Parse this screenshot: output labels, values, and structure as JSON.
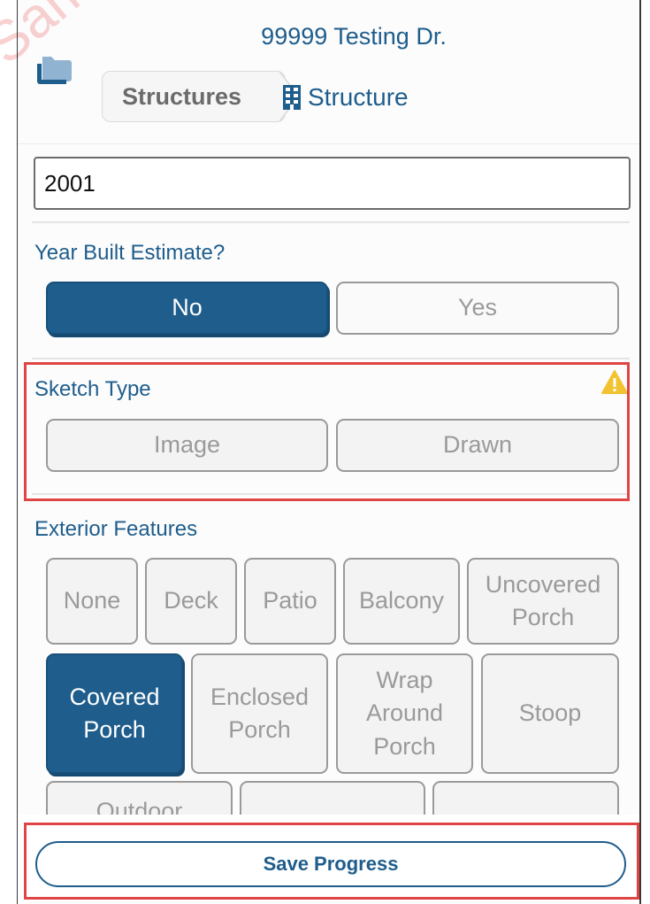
{
  "header": {
    "title": "99999 Testing Dr.",
    "breadcrumb": [
      {
        "label": "Structures",
        "icon": "folder-icon"
      },
      {
        "label": "Structure",
        "icon": "building-icon"
      }
    ]
  },
  "year_built": {
    "value": "2001"
  },
  "year_estimate": {
    "label": "Year Built Estimate?",
    "options": [
      "No",
      "Yes"
    ],
    "selected": "No"
  },
  "sketch_type": {
    "label": "Sketch Type",
    "options": [
      "Image",
      "Drawn"
    ],
    "selected": null,
    "status_icon": "warning-icon"
  },
  "exterior_features": {
    "label": "Exterior Features",
    "options": [
      "None",
      "Deck",
      "Patio",
      "Balcony",
      "Uncovered Porch",
      "Covered Porch",
      "Enclosed Porch",
      "Wrap Around Porch",
      "Stoop",
      "Outdoor"
    ],
    "selected": [
      "Covered Porch"
    ]
  },
  "footer": {
    "save_label": "Save Progress"
  },
  "watermark_text": "Sample Project LLC",
  "colors": {
    "accent": "#1e5d8c",
    "highlight": "#e04545",
    "warning": "#f2c230",
    "disabled_text": "#9a9a9a"
  }
}
